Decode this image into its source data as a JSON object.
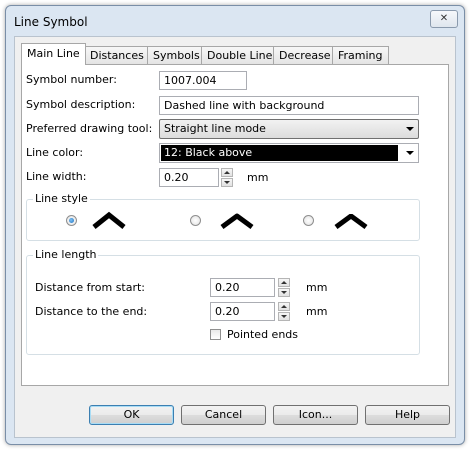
{
  "window": {
    "title": "Line Symbol",
    "close_glyph": "✕"
  },
  "tabs": [
    {
      "label": "Main Line",
      "active": true
    },
    {
      "label": "Distances"
    },
    {
      "label": "Symbols"
    },
    {
      "label": "Double Line"
    },
    {
      "label": "Decrease"
    },
    {
      "label": "Framing"
    }
  ],
  "main": {
    "symbol_number": {
      "label": "Symbol number:",
      "value": "1007.004"
    },
    "symbol_description": {
      "label": "Symbol description:",
      "value": "Dashed line with background"
    },
    "drawing_tool": {
      "label": "Preferred drawing tool:",
      "value": "Straight line mode"
    },
    "line_color": {
      "label": "Line color:",
      "value": "12: Black above",
      "swatch": "#000000"
    },
    "line_width": {
      "label": "Line width:",
      "value": "0.20",
      "unit": "mm"
    },
    "line_style": {
      "title": "Line style",
      "options": [
        {
          "icon": "miter-join-chevron-icon",
          "selected": true
        },
        {
          "icon": "round-join-chevron-icon",
          "selected": false
        },
        {
          "icon": "bevel-join-chevron-icon",
          "selected": false
        }
      ]
    },
    "line_length": {
      "title": "Line length",
      "distance_start": {
        "label": "Distance from start:",
        "value": "0.20",
        "unit": "mm"
      },
      "distance_end": {
        "label": "Distance to the end:",
        "value": "0.20",
        "unit": "mm"
      },
      "pointed_ends": {
        "label": "Pointed ends",
        "checked": false
      }
    }
  },
  "buttons": {
    "ok": "OK",
    "cancel": "Cancel",
    "icon": "Icon...",
    "help": "Help"
  }
}
